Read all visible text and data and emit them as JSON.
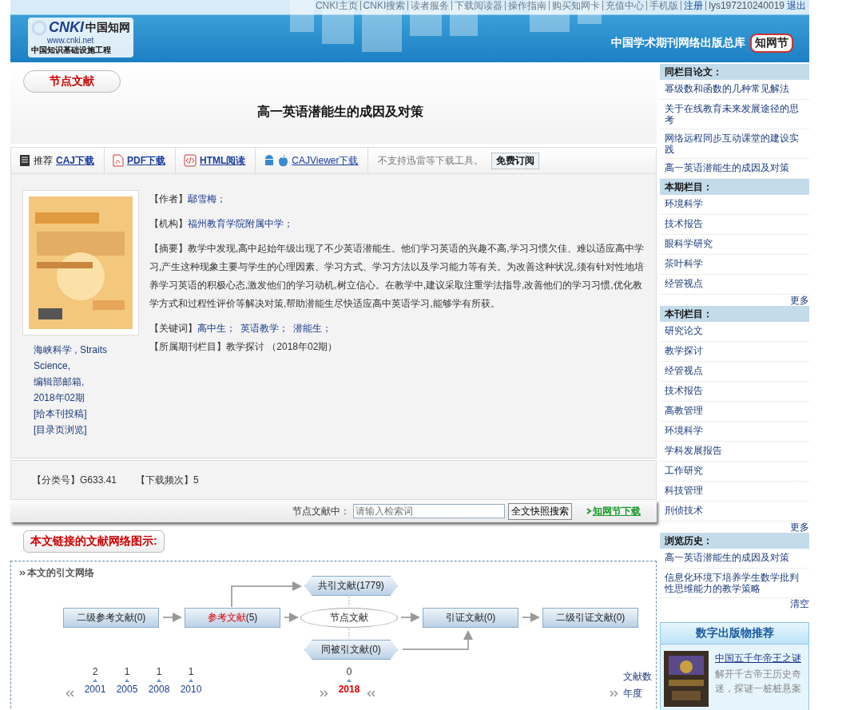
{
  "top_links": [
    "CNKI主页",
    "CNKI搜索",
    "读者服务",
    "下载阅读器",
    "操作指南",
    "购买知网卡",
    "充值中心",
    "手机版",
    "注册"
  ],
  "user": {
    "name": "lys197210240019",
    "logout": "退出"
  },
  "header": {
    "logo_brand": "CNKI",
    "logo_cn": "中国知网",
    "logo_url": "www.cnki.net",
    "logo_sub": "中国知识基础设施工程",
    "site_title": "中国学术期刊网络出版总库",
    "badge": "知网节"
  },
  "section_tab": "节点文献",
  "title": "高一英语潜能生的成因及对策",
  "toolbar": {
    "items": [
      {
        "kind": "caj",
        "prefix": "推荐",
        "label": "CAJ下载"
      },
      {
        "kind": "pdf",
        "label": "PDF下载"
      },
      {
        "kind": "html",
        "label": "HTML阅读"
      },
      {
        "kind": "viewer",
        "label": "CAJViewer下载"
      }
    ],
    "note": "不支持迅雷等下载工具。",
    "subscribe": "免费订阅"
  },
  "journal": {
    "cover": {
      "kind": "picture"
    },
    "lines": [
      "海峡科学 , Straits Science,",
      "编辑部邮箱,",
      "2018年02期"
    ],
    "links": [
      "[给本刊投稿]",
      "[目录页浏览]"
    ]
  },
  "meta": {
    "author_label": "【作者】",
    "authors": [
      "鄢雪梅；"
    ],
    "institution_label": "【机构】",
    "institutions": [
      "福州教育学院附属中学；"
    ],
    "abstract_label": "【摘要】",
    "abstract": "教学中发现,高中起始年级出现了不少英语潜能生。他们学习英语的兴趣不高,学习习惯欠佳、难以适应高中学习,产生这种现象主要与学生的心理因素、学习方式、学习方法以及学习能力等有关。为改善这种状况,须有针对性地培养学习英语的积极心态,激发他们的学习动机,树立信心。在教学中,建议采取注重学法指导,改善他们的学习习惯,优化教学方式和过程性评价等解决对策,帮助潜能生尽快适应高中英语学习,能够学有所获。",
    "keywords_label": "【关键词】",
    "keywords": [
      "高中生；",
      "英语教学；",
      "潜能生；"
    ],
    "column_label": "【所属期刊栏目】",
    "column": "教学探讨 （2018年02期）"
  },
  "classification": {
    "code_label": "【分类号】",
    "code": "G633.41",
    "downloads_label": "【下载频次】",
    "downloads": "5"
  },
  "search": {
    "label": "节点文献中：",
    "placeholder": "请输入检索词",
    "button": "全文快照搜索",
    "download": "知网节下载"
  },
  "network_heading": "本文链接的文献网络图示:",
  "network": {
    "title": "本文的引文网络",
    "nodes": [
      {
        "kind": "box",
        "label": "二级参考文献",
        "count": "(0)",
        "selected": false
      },
      {
        "kind": "box",
        "label": "参考文献",
        "count": "(5)",
        "selected": true
      },
      {
        "kind": "center",
        "label": "节点文献",
        "selected": false
      },
      {
        "kind": "box",
        "label": "引证文献",
        "count": "(0)",
        "selected": false
      },
      {
        "kind": "box",
        "label": "二级引证文献",
        "count": "(0)",
        "selected": false
      },
      {
        "kind": "hex",
        "label": "共引文献",
        "count": "(1779)",
        "selected": false
      },
      {
        "kind": "hex",
        "label": "同被引文献",
        "count": "(0)",
        "selected": false
      }
    ],
    "left_years": [
      {
        "count": "2",
        "year": "2001",
        "selected": false
      },
      {
        "count": "1",
        "year": "2005",
        "selected": false
      },
      {
        "count": "1",
        "year": "2008",
        "selected": false
      },
      {
        "count": "1",
        "year": "2010",
        "selected": false
      }
    ],
    "right_years": [
      {
        "count": "0",
        "year": "2018",
        "selected": true
      }
    ],
    "count_label": "文献数",
    "year_label": "年度"
  },
  "sidebar": [
    {
      "heading": "同栏目论文：",
      "items": [
        "幂级数和函数的几种常见解法",
        "关于在线教育未来发展途径的思考",
        "网络远程同步互动课堂的建设实践",
        "高一英语潜能生的成因及对策"
      ]
    },
    {
      "heading": "本期栏目：",
      "items": [
        "环境科学",
        "技术报告",
        "眼科学研究",
        "茶叶科学",
        "经管视点"
      ],
      "footer": "更多"
    },
    {
      "heading": "本刊栏目：",
      "items": [
        "研究论文",
        "教学探讨",
        "经管视点",
        "技术报告",
        "高教管理",
        "环境科学",
        "学科发展报告",
        "工作研究",
        "科技管理",
        "刑侦技术"
      ],
      "footer": "更多"
    },
    {
      "heading": "浏览历史：",
      "items": [
        "高一英语潜能生的成因及对策",
        "信息化环境下培养学生数学批判性思维能力的教学策略"
      ],
      "footer": "清空"
    }
  ],
  "promo": {
    "heading": "数字出版物推荐",
    "book": {
      "kind": "picture"
    },
    "title": "中国五千年帝王之谜",
    "description": "解开千古帝王历史奇迷，探谜一桩桩悬案"
  }
}
